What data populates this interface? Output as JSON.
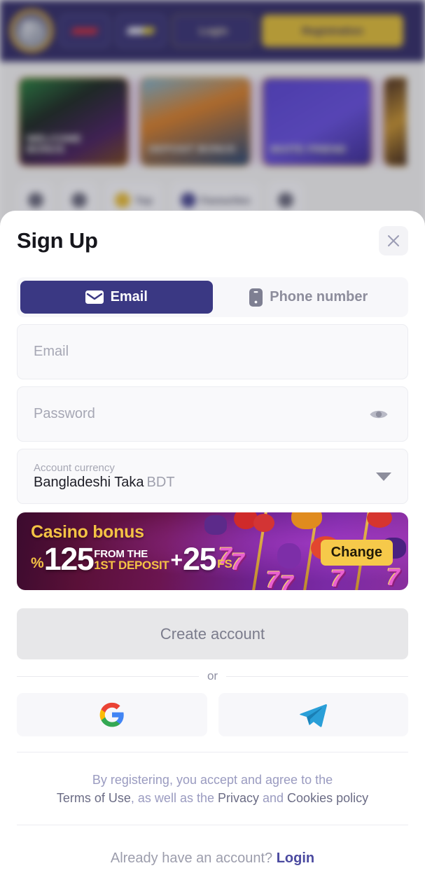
{
  "background": {
    "header": {
      "logo_icon": "shield-logo-icon",
      "sport_tab_icon": "sport-logo-icon",
      "casino_tab_icon": "casino-logo-icon",
      "login_label": "Login",
      "registration_label": "Registration"
    },
    "promo_cards": [
      {
        "title": "WELCOME BONUS"
      },
      {
        "title": "DEPOSIT BONUS"
      },
      {
        "title": "INVITE FRIEND"
      },
      {
        "title": ""
      }
    ],
    "nav_items": [
      {
        "label": "",
        "icon": "search-icon"
      },
      {
        "label": "",
        "icon": "grid-icon"
      },
      {
        "label": "Top",
        "icon": "crown-icon"
      },
      {
        "label": "Favourites",
        "icon": "telegram-icon"
      },
      {
        "label": "",
        "icon": "user-icon"
      }
    ]
  },
  "modal": {
    "title": "Sign Up",
    "close_icon": "close-icon",
    "tabs": [
      {
        "label": "Email",
        "icon": "envelope-icon",
        "active": true
      },
      {
        "label": "Phone number",
        "icon": "phone-icon",
        "active": false
      }
    ],
    "fields": {
      "email": {
        "placeholder": "Email",
        "value": ""
      },
      "password": {
        "placeholder": "Password",
        "value": "",
        "toggle_icon": "eye-icon"
      }
    },
    "currency": {
      "label": "Account currency",
      "value": "Bangladeshi Taka",
      "code": "BDT",
      "caret_icon": "chevron-down-icon"
    },
    "bonus": {
      "title": "Casino bonus",
      "percent_sign": "%",
      "percent_value": "125",
      "from_the": "FROM THE",
      "first_deposit": "1ST DEPOSIT",
      "plus": "+",
      "free_spins_value": "25",
      "free_spins_unit": "FS",
      "change_label": "Change"
    },
    "submit_label": "Create account",
    "or_label": "or",
    "socials": [
      {
        "name": "google",
        "icon": "google-icon"
      },
      {
        "name": "telegram",
        "icon": "telegram-icon"
      }
    ],
    "legal": {
      "line1": "By registering, you accept and agree to the",
      "terms": "Terms of Use",
      "mid": ", as well as the ",
      "privacy": "Privacy",
      "and": " and ",
      "cookies": "Cookies policy"
    },
    "footer": {
      "question": "Already have an account? ",
      "login_label": "Login"
    }
  },
  "colors": {
    "accent_indigo": "#3a3883",
    "accent_yellow": "#f6c94a",
    "header_navy": "#241e5c",
    "link_indigo": "#4b4aa0"
  }
}
